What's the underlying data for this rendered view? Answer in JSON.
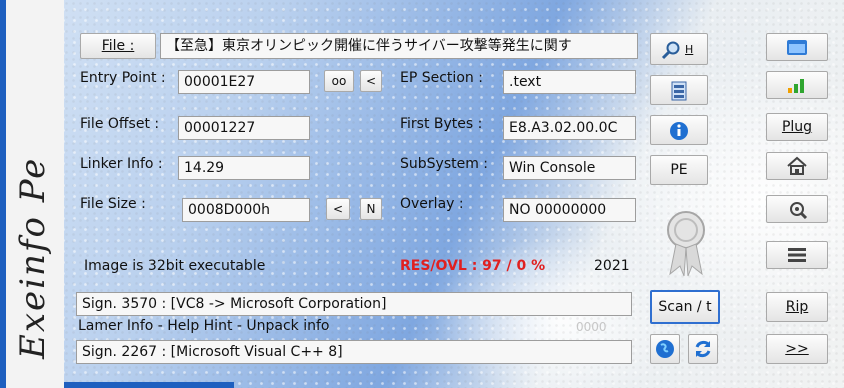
{
  "brand": {
    "name": "Exeinfo Pe"
  },
  "file": {
    "button_label": "File :",
    "value": "【至急】東京オリンピック開催に伴うサイバー攻撃等発生に関す"
  },
  "entry_point": {
    "label": "Entry Point :",
    "value": "00001E27",
    "oo_label": "oo",
    "back_label": "<"
  },
  "ep_section": {
    "label": "EP Section :",
    "value": ".text"
  },
  "file_offset": {
    "label": "File Offset :",
    "value": "00001227"
  },
  "first_bytes": {
    "label": "First Bytes :",
    "value": "E8.A3.02.00.0C"
  },
  "linker_info": {
    "label": "Linker Info :",
    "value": "14.29"
  },
  "subsystem": {
    "label": "SubSystem :",
    "value": "Win Console"
  },
  "file_size": {
    "label": "File Size :",
    "value": "0008D000h",
    "back_label": "<",
    "n_label": "N"
  },
  "overlay": {
    "label": "Overlay :",
    "value": "NO  00000000"
  },
  "image_info": {
    "text": "Image is 32bit executable",
    "res_ovl": "RES/OVL : 97 / 0 %",
    "year": "2021"
  },
  "signature1": {
    "value": "Sign. 3570 : [VC8 -> Microsoft Corporation]"
  },
  "lamer_info": {
    "text": "Lamer Info - Help Hint - Unpack info",
    "counter": "0000"
  },
  "signature2": {
    "value": "Sign. 2267 : [Microsoft Visual C++ 8]"
  },
  "buttons": {
    "search_h": "H",
    "pe": "PE",
    "scan": "Scan / t",
    "plug": "Plug",
    "rip": "Rip",
    "more": ">>"
  },
  "colors": {
    "accent": "#1e5fbf",
    "res_ovl": "#e02020",
    "bar_green": "#2fa52f",
    "bar_orange": "#f0a000"
  }
}
